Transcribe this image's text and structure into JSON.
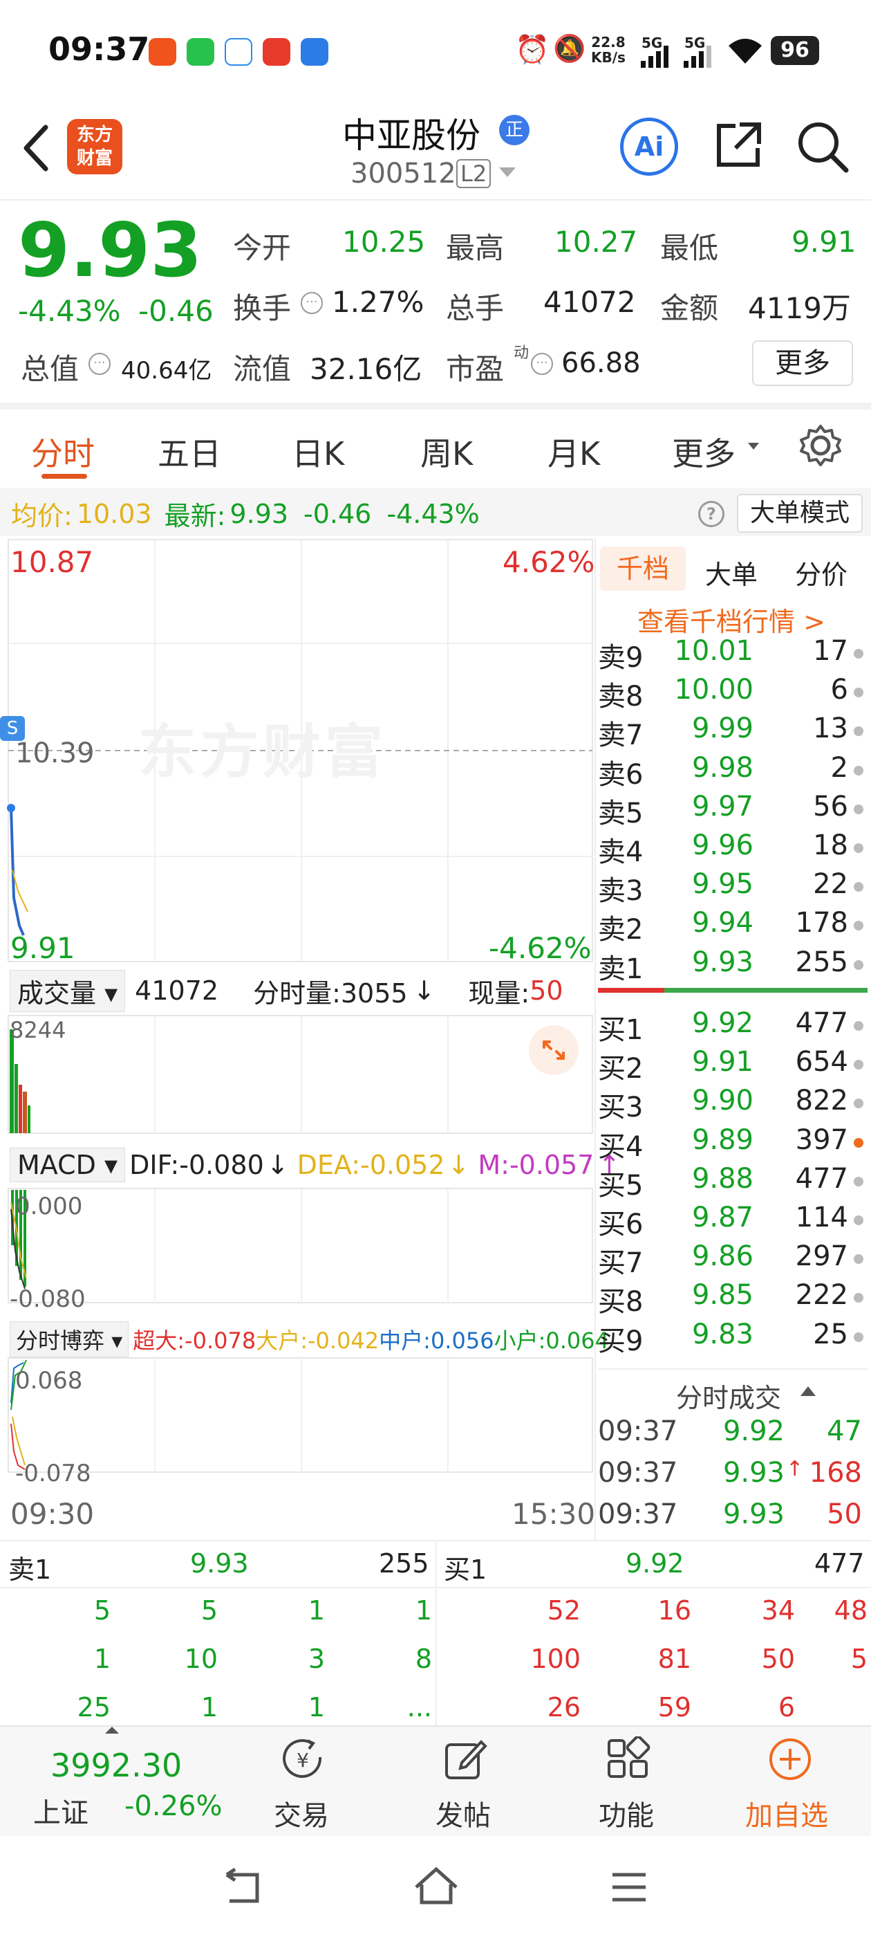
{
  "status_bar": {
    "time": "09:37",
    "net_speed_top": "22.8",
    "net_speed_bottom": "KB/s",
    "sig1": "5G",
    "sig2": "5G",
    "battery": "96"
  },
  "header": {
    "logo_line1": "东方",
    "logo_line2": "财富",
    "stock_name": "中亚股份",
    "badge": "正",
    "stock_code": "300512",
    "level": "L2",
    "ai_label": "Ai"
  },
  "quote": {
    "price": "9.93",
    "change_pct": "-4.43%",
    "change": "-0.46",
    "labels": {
      "open": "今开",
      "high": "最高",
      "low": "最低",
      "turnover_rate": "换手",
      "volume": "总手",
      "amount": "金额",
      "total_cap": "总值",
      "float_cap": "流值",
      "pe": "市盈",
      "pe_sup": "动",
      "more": "更多"
    },
    "values": {
      "open": "10.25",
      "high": "10.27",
      "low": "9.91",
      "turnover_rate": "1.27%",
      "volume": "41072",
      "amount": "4119万",
      "total_cap": "40.64亿",
      "float_cap": "32.16亿",
      "pe": "66.88"
    }
  },
  "tabs": [
    "分时",
    "五日",
    "日K",
    "周K",
    "月K",
    "更多"
  ],
  "summary": {
    "avg_label": "均价:",
    "avg": "10.03",
    "latest_label": "最新:",
    "latest": "9.93",
    "chg": "-0.46",
    "chg_pct": "-4.43%",
    "big_order_mode": "大单模式"
  },
  "chart": {
    "y_top": "10.87",
    "y_top_pct": "4.62%",
    "y_mid": "10.39",
    "y_bottom": "9.91",
    "y_bottom_pct": "-4.62%",
    "watermark": "东方财富",
    "s_marker": "S"
  },
  "volume": {
    "label": "成交量",
    "total": "41072",
    "tick_label": "分时量:3055",
    "tick_arrow": "↓",
    "now_label": "现量:",
    "now": "50",
    "y_max": "8244"
  },
  "macd": {
    "label": "MACD",
    "dif": "DIF:-0.080",
    "dif_arrow": "↓",
    "dea": "DEA:-0.052",
    "dea_arrow": "↓",
    "m": "M:-0.057",
    "m_arrow": "↑",
    "y_top": "0.000",
    "y_bottom": "-0.080"
  },
  "game": {
    "label": "分时博弈",
    "super": "超大:-0.078",
    "big": "大户:-0.042",
    "mid": "中户:0.056",
    "small": "小户:0.064",
    "y_top": "0.068",
    "y_bottom": "-0.078"
  },
  "time_axis": {
    "start": "09:30",
    "end": "15:30"
  },
  "orderbook": {
    "tabs": [
      "千档",
      "大单",
      "分价"
    ],
    "link": "查看千档行情 >",
    "asks": [
      {
        "label": "卖9",
        "price": "10.01",
        "vol": "17"
      },
      {
        "label": "卖8",
        "price": "10.00",
        "vol": "6"
      },
      {
        "label": "卖7",
        "price": "9.99",
        "vol": "13"
      },
      {
        "label": "卖6",
        "price": "9.98",
        "vol": "2"
      },
      {
        "label": "卖5",
        "price": "9.97",
        "vol": "56"
      },
      {
        "label": "卖4",
        "price": "9.96",
        "vol": "18"
      },
      {
        "label": "卖3",
        "price": "9.95",
        "vol": "22"
      },
      {
        "label": "卖2",
        "price": "9.94",
        "vol": "178"
      },
      {
        "label": "卖1",
        "price": "9.93",
        "vol": "255"
      }
    ],
    "bids": [
      {
        "label": "买1",
        "price": "9.92",
        "vol": "477"
      },
      {
        "label": "买2",
        "price": "9.91",
        "vol": "654"
      },
      {
        "label": "买3",
        "price": "9.90",
        "vol": "822"
      },
      {
        "label": "买4",
        "price": "9.89",
        "vol": "397"
      },
      {
        "label": "买5",
        "price": "9.88",
        "vol": "477"
      },
      {
        "label": "买6",
        "price": "9.87",
        "vol": "114"
      },
      {
        "label": "买7",
        "price": "9.86",
        "vol": "297"
      },
      {
        "label": "买8",
        "price": "9.85",
        "vol": "222"
      },
      {
        "label": "买9",
        "price": "9.83",
        "vol": "25"
      }
    ],
    "trades_title": "分时成交",
    "trades": [
      {
        "time": "09:37",
        "price": "9.92",
        "arrow": "",
        "vol": "47"
      },
      {
        "time": "09:37",
        "price": "9.93",
        "arrow": "↑",
        "vol": "168"
      },
      {
        "time": "09:37",
        "price": "9.93",
        "arrow": "",
        "vol": "50"
      }
    ]
  },
  "queue": {
    "ask_label": "卖1",
    "ask_price": "9.93",
    "ask_vol": "255",
    "bid_label": "买1",
    "bid_price": "9.92",
    "bid_vol": "477",
    "ask_rows": [
      [
        "5",
        "5",
        "1",
        "1"
      ],
      [
        "1",
        "10",
        "3",
        "8"
      ],
      [
        "25",
        "1",
        "1",
        "..."
      ]
    ],
    "bid_rows": [
      [
        "52",
        "16",
        "34",
        "48"
      ],
      [
        "100",
        "81",
        "50",
        "5"
      ],
      [
        "26",
        "59",
        "6",
        ""
      ]
    ]
  },
  "bottom_bar": {
    "index_value": "3992.30",
    "index_name": "上证",
    "index_chg": "-0.26%",
    "trade": "交易",
    "post": "发帖",
    "func": "功能",
    "watch": "加自选"
  }
}
